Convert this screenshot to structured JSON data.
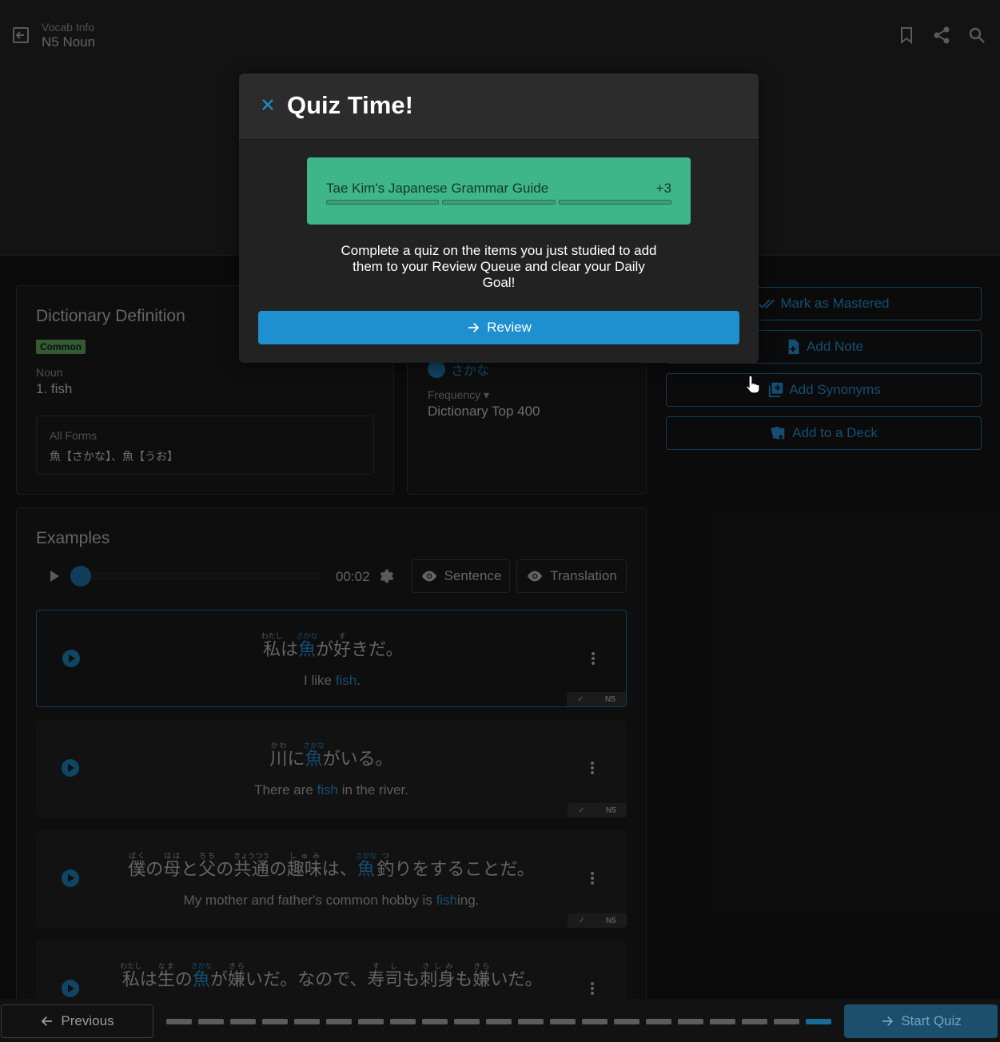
{
  "header": {
    "breadcrumb_small": "Vocab Info",
    "breadcrumb_title": "N5 Noun"
  },
  "definition": {
    "title": "Dictionary Definition",
    "badge": "Common",
    "pos": "Noun",
    "meaning": "1.  fish",
    "forms_label": "All Forms",
    "forms_value": "魚【さかな】、魚【うお】"
  },
  "info": {
    "reading": "さかな",
    "frequency_label": "Frequency",
    "frequency_value": "Dictionary Top 400"
  },
  "actions": {
    "mastered": "Mark as Mastered",
    "note": "Add Note",
    "synonyms": "Add Synonyms",
    "deck": "Add to a Deck"
  },
  "examples": {
    "title": "Examples",
    "time": "00:02",
    "sentence_label": "Sentence",
    "translation_label": "Translation",
    "tag_level": "N5",
    "items": [
      {
        "en_before": "I like ",
        "en_hl": "fish",
        "en_after": ".",
        "r1": "私",
        "f1": "わたし",
        "t1": "は",
        "r2": "魚",
        "f2": "さかな",
        "t2": "が",
        "r3": "好",
        "f3": "す",
        "t3": "きだ。"
      },
      {
        "en_before": "There are ",
        "en_hl": "fish",
        "en_after": " in the river.",
        "r1": "川",
        "f1": "かわ",
        "t1": "に",
        "r2": "魚",
        "f2": "さかな",
        "t2": "がいる。"
      },
      {
        "en_before": "My mother and father's common hobby is ",
        "en_hl": "fish",
        "en_after": "ing.",
        "r1": "僕",
        "f1": "ぼく",
        "t1": "の",
        "r2": "母",
        "f2": "はは",
        "t2": "と",
        "r3": "父",
        "f3": "ちち",
        "t3": "の",
        "r4": "共通",
        "f4": "きょうつう",
        "t4": "の",
        "r5": "趣味",
        "f5": "しゅみ",
        "t5": "は、",
        "r6": "魚",
        "f6": "さかな",
        "r7": "釣",
        "f7": "つ",
        "t6": "りをすることだ。"
      },
      {
        "r1": "私",
        "f1": "わたし",
        "t1": "は",
        "r2": "生",
        "f2": "なま",
        "t2": "の",
        "r3": "魚",
        "f3": "さかな",
        "t3": "が",
        "r4": "嫌",
        "f4": "きら",
        "t4": "いだ。なので、",
        "r5": "寿司",
        "f5": "すし",
        "t5": "も",
        "r6": "刺身",
        "f6": "さしみ",
        "t6": "も",
        "r7": "嫌",
        "f7": "きら",
        "t7": "いだ。"
      }
    ]
  },
  "footer": {
    "previous": "Previous",
    "start_quiz": "Start Quiz",
    "progress_total": 21,
    "progress_current": 21
  },
  "modal": {
    "title": "Quiz Time!",
    "guide_name": "Tae Kim's Japanese Grammar Guide",
    "guide_count": "+3",
    "description": "Complete a quiz on the items you just studied to add them to your Review Queue and clear your Daily Goal!",
    "review_label": "Review"
  },
  "colors": {
    "accent": "#1f78ae",
    "guide_card": "#3fb58a",
    "review_button": "#1e90cf",
    "badge": "#4f8a4f"
  }
}
